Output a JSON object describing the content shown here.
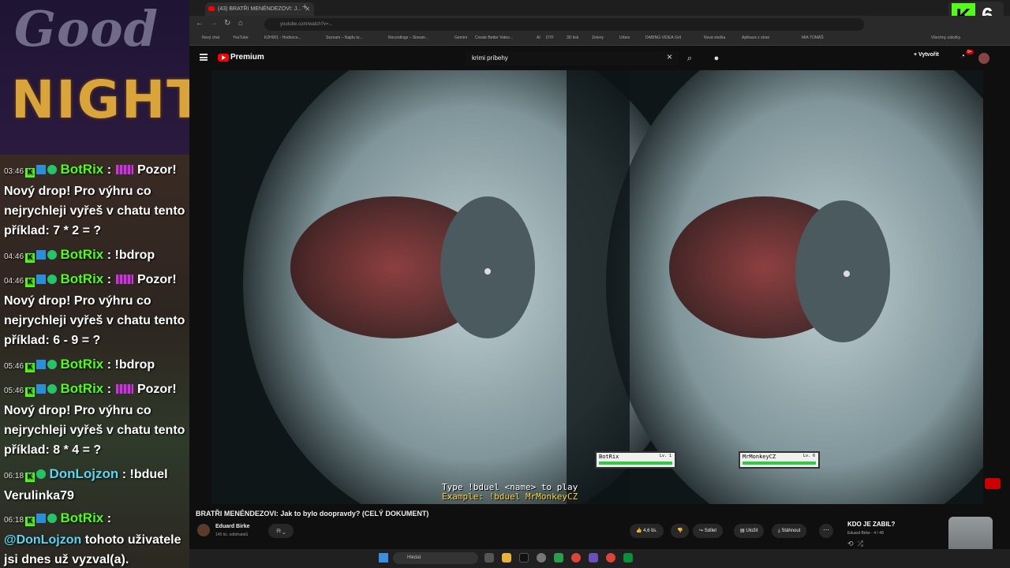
{
  "overlay": {
    "brand_line1": "Good",
    "brand_line2": "NIGHT"
  },
  "chat": [
    {
      "time": "03:46",
      "user": "BotRix",
      "user_class": "bot",
      "text": "Pozor! Nový drop! Pro výhru co nejrychleji vyřeš v chatu tento příklad: 7 * 2 = ?"
    },
    {
      "time": "04:46",
      "user": "BotRix",
      "user_class": "bot",
      "text": "!bdrop"
    },
    {
      "time": "04:46",
      "user": "BotRix",
      "user_class": "bot",
      "text": "Pozor! Nový drop! Pro výhru co nejrychleji vyřeš v chatu tento příklad: 6 - 9 = ?"
    },
    {
      "time": "05:46",
      "user": "BotRix",
      "user_class": "bot",
      "text": "!bdrop"
    },
    {
      "time": "05:46",
      "user": "BotRix",
      "user_class": "bot",
      "text": "Pozor! Nový drop! Pro výhru co nejrychleji vyřeš v chatu tento příklad: 8 * 4 = ?"
    },
    {
      "time": "06:18",
      "user": "DonLojzon",
      "user_class": "don",
      "text": "!bduel Verulinka79"
    },
    {
      "time": "06:18",
      "user": "BotRix",
      "user_class": "bot",
      "mention": "@DonLojzon",
      "text": "tohoto uživatele jsi dnes už vyzval(a)."
    }
  ],
  "browser": {
    "tab_title": "(43) BRATŘI MENÉNDEZOVI: J...",
    "url": "youtube.com/watch?v=...",
    "bookmarks": [
      "Nový chat",
      "YouTube",
      "K2H001 - Hodnoce...",
      "Seznam – Najdu to...",
      "Recordings – Stream...",
      "Gemini",
      "Create Better Video...",
      "AI",
      "DTF",
      "3D tisk",
      "Zeleny",
      "Urbex",
      "DABING VIDEA",
      "Grit",
      "Nová složka",
      "Aplikace z stran",
      "MIA TOMÁŠ",
      "Všechny záložky"
    ],
    "kick_count": "6"
  },
  "youtube": {
    "logo_text": "Premium",
    "search_query": "krimi príbehy",
    "create_label": "Vytvořit",
    "notif_count": "9+",
    "video_title": "BRATŘI MENÉNDEZOVI: Jak to bylo doopravdy? (CELÝ DOKUMENT)",
    "channel_name": "Eduard Birke",
    "channel_subs": "145 tis. odběratelů",
    "likes": "4,6 tis.",
    "share_label": "Sdílet",
    "save_label": "Uložit",
    "download_label": "Stáhnout",
    "playlist_title": "KDO JE ZABIL?",
    "playlist_meta": "Eduard Birke - 4 / 48"
  },
  "video_overlay": {
    "player1_name": "BotRix",
    "player1_level": "Lv. 1",
    "player1_hp": 1.0,
    "player2_name": "MrMonkeyCZ",
    "player2_level": "Lv. 6",
    "player2_hp": 1.0,
    "hint_line1": "Type !bduel <name> to play",
    "hint_line2": "Example: !bduel MrMonkeyCZ"
  },
  "taskbar": {
    "search_placeholder": "Hledat"
  },
  "colors": {
    "kick_green": "#53fc18",
    "yt_red": "#ff0000",
    "chat_name_bot": "#53fc18",
    "chat_name_don": "#59d6f0",
    "brand_gold": "#d9a53a"
  }
}
